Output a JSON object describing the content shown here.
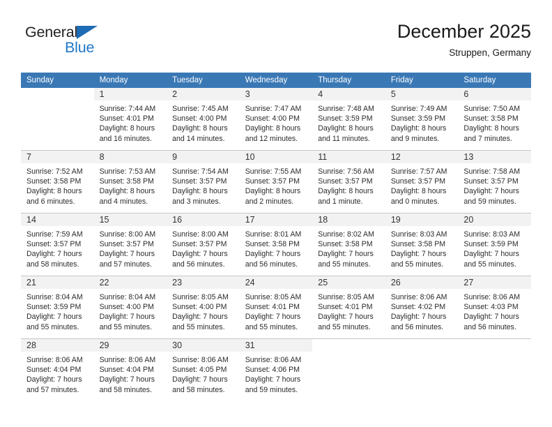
{
  "brand": {
    "name_part1": "General",
    "name_part2": "Blue",
    "triangle_color": "#1e6cb5",
    "blue_color": "#1e77c8"
  },
  "header": {
    "title": "December 2025",
    "subtitle": "Struppen, Germany"
  },
  "theme": {
    "header_row_background": "#3a78b5",
    "header_row_text": "#ffffff",
    "daynum_band_background": "#f2f2f2",
    "grid_line": "#c8c8c8"
  },
  "weekdays": [
    "Sunday",
    "Monday",
    "Tuesday",
    "Wednesday",
    "Thursday",
    "Friday",
    "Saturday"
  ],
  "weeks": [
    [
      {
        "day": "",
        "blank": true,
        "sunrise": "",
        "sunset": "",
        "daylight_line1": "",
        "daylight_line2": ""
      },
      {
        "day": "1",
        "sunrise": "Sunrise: 7:44 AM",
        "sunset": "Sunset: 4:01 PM",
        "daylight_line1": "Daylight: 8 hours",
        "daylight_line2": "and 16 minutes."
      },
      {
        "day": "2",
        "sunrise": "Sunrise: 7:45 AM",
        "sunset": "Sunset: 4:00 PM",
        "daylight_line1": "Daylight: 8 hours",
        "daylight_line2": "and 14 minutes."
      },
      {
        "day": "3",
        "sunrise": "Sunrise: 7:47 AM",
        "sunset": "Sunset: 4:00 PM",
        "daylight_line1": "Daylight: 8 hours",
        "daylight_line2": "and 12 minutes."
      },
      {
        "day": "4",
        "sunrise": "Sunrise: 7:48 AM",
        "sunset": "Sunset: 3:59 PM",
        "daylight_line1": "Daylight: 8 hours",
        "daylight_line2": "and 11 minutes."
      },
      {
        "day": "5",
        "sunrise": "Sunrise: 7:49 AM",
        "sunset": "Sunset: 3:59 PM",
        "daylight_line1": "Daylight: 8 hours",
        "daylight_line2": "and 9 minutes."
      },
      {
        "day": "6",
        "sunrise": "Sunrise: 7:50 AM",
        "sunset": "Sunset: 3:58 PM",
        "daylight_line1": "Daylight: 8 hours",
        "daylight_line2": "and 7 minutes."
      }
    ],
    [
      {
        "day": "7",
        "sunrise": "Sunrise: 7:52 AM",
        "sunset": "Sunset: 3:58 PM",
        "daylight_line1": "Daylight: 8 hours",
        "daylight_line2": "and 6 minutes."
      },
      {
        "day": "8",
        "sunrise": "Sunrise: 7:53 AM",
        "sunset": "Sunset: 3:58 PM",
        "daylight_line1": "Daylight: 8 hours",
        "daylight_line2": "and 4 minutes."
      },
      {
        "day": "9",
        "sunrise": "Sunrise: 7:54 AM",
        "sunset": "Sunset: 3:57 PM",
        "daylight_line1": "Daylight: 8 hours",
        "daylight_line2": "and 3 minutes."
      },
      {
        "day": "10",
        "sunrise": "Sunrise: 7:55 AM",
        "sunset": "Sunset: 3:57 PM",
        "daylight_line1": "Daylight: 8 hours",
        "daylight_line2": "and 2 minutes."
      },
      {
        "day": "11",
        "sunrise": "Sunrise: 7:56 AM",
        "sunset": "Sunset: 3:57 PM",
        "daylight_line1": "Daylight: 8 hours",
        "daylight_line2": "and 1 minute."
      },
      {
        "day": "12",
        "sunrise": "Sunrise: 7:57 AM",
        "sunset": "Sunset: 3:57 PM",
        "daylight_line1": "Daylight: 8 hours",
        "daylight_line2": "and 0 minutes."
      },
      {
        "day": "13",
        "sunrise": "Sunrise: 7:58 AM",
        "sunset": "Sunset: 3:57 PM",
        "daylight_line1": "Daylight: 7 hours",
        "daylight_line2": "and 59 minutes."
      }
    ],
    [
      {
        "day": "14",
        "sunrise": "Sunrise: 7:59 AM",
        "sunset": "Sunset: 3:57 PM",
        "daylight_line1": "Daylight: 7 hours",
        "daylight_line2": "and 58 minutes."
      },
      {
        "day": "15",
        "sunrise": "Sunrise: 8:00 AM",
        "sunset": "Sunset: 3:57 PM",
        "daylight_line1": "Daylight: 7 hours",
        "daylight_line2": "and 57 minutes."
      },
      {
        "day": "16",
        "sunrise": "Sunrise: 8:00 AM",
        "sunset": "Sunset: 3:57 PM",
        "daylight_line1": "Daylight: 7 hours",
        "daylight_line2": "and 56 minutes."
      },
      {
        "day": "17",
        "sunrise": "Sunrise: 8:01 AM",
        "sunset": "Sunset: 3:58 PM",
        "daylight_line1": "Daylight: 7 hours",
        "daylight_line2": "and 56 minutes."
      },
      {
        "day": "18",
        "sunrise": "Sunrise: 8:02 AM",
        "sunset": "Sunset: 3:58 PM",
        "daylight_line1": "Daylight: 7 hours",
        "daylight_line2": "and 55 minutes."
      },
      {
        "day": "19",
        "sunrise": "Sunrise: 8:03 AM",
        "sunset": "Sunset: 3:58 PM",
        "daylight_line1": "Daylight: 7 hours",
        "daylight_line2": "and 55 minutes."
      },
      {
        "day": "20",
        "sunrise": "Sunrise: 8:03 AM",
        "sunset": "Sunset: 3:59 PM",
        "daylight_line1": "Daylight: 7 hours",
        "daylight_line2": "and 55 minutes."
      }
    ],
    [
      {
        "day": "21",
        "sunrise": "Sunrise: 8:04 AM",
        "sunset": "Sunset: 3:59 PM",
        "daylight_line1": "Daylight: 7 hours",
        "daylight_line2": "and 55 minutes."
      },
      {
        "day": "22",
        "sunrise": "Sunrise: 8:04 AM",
        "sunset": "Sunset: 4:00 PM",
        "daylight_line1": "Daylight: 7 hours",
        "daylight_line2": "and 55 minutes."
      },
      {
        "day": "23",
        "sunrise": "Sunrise: 8:05 AM",
        "sunset": "Sunset: 4:00 PM",
        "daylight_line1": "Daylight: 7 hours",
        "daylight_line2": "and 55 minutes."
      },
      {
        "day": "24",
        "sunrise": "Sunrise: 8:05 AM",
        "sunset": "Sunset: 4:01 PM",
        "daylight_line1": "Daylight: 7 hours",
        "daylight_line2": "and 55 minutes."
      },
      {
        "day": "25",
        "sunrise": "Sunrise: 8:05 AM",
        "sunset": "Sunset: 4:01 PM",
        "daylight_line1": "Daylight: 7 hours",
        "daylight_line2": "and 55 minutes."
      },
      {
        "day": "26",
        "sunrise": "Sunrise: 8:06 AM",
        "sunset": "Sunset: 4:02 PM",
        "daylight_line1": "Daylight: 7 hours",
        "daylight_line2": "and 56 minutes."
      },
      {
        "day": "27",
        "sunrise": "Sunrise: 8:06 AM",
        "sunset": "Sunset: 4:03 PM",
        "daylight_line1": "Daylight: 7 hours",
        "daylight_line2": "and 56 minutes."
      }
    ],
    [
      {
        "day": "28",
        "sunrise": "Sunrise: 8:06 AM",
        "sunset": "Sunset: 4:04 PM",
        "daylight_line1": "Daylight: 7 hours",
        "daylight_line2": "and 57 minutes."
      },
      {
        "day": "29",
        "sunrise": "Sunrise: 8:06 AM",
        "sunset": "Sunset: 4:04 PM",
        "daylight_line1": "Daylight: 7 hours",
        "daylight_line2": "and 58 minutes."
      },
      {
        "day": "30",
        "sunrise": "Sunrise: 8:06 AM",
        "sunset": "Sunset: 4:05 PM",
        "daylight_line1": "Daylight: 7 hours",
        "daylight_line2": "and 58 minutes."
      },
      {
        "day": "31",
        "sunrise": "Sunrise: 8:06 AM",
        "sunset": "Sunset: 4:06 PM",
        "daylight_line1": "Daylight: 7 hours",
        "daylight_line2": "and 59 minutes."
      },
      {
        "day": "",
        "blank": true,
        "sunrise": "",
        "sunset": "",
        "daylight_line1": "",
        "daylight_line2": ""
      },
      {
        "day": "",
        "blank": true,
        "sunrise": "",
        "sunset": "",
        "daylight_line1": "",
        "daylight_line2": ""
      },
      {
        "day": "",
        "blank": true,
        "sunrise": "",
        "sunset": "",
        "daylight_line1": "",
        "daylight_line2": ""
      }
    ]
  ]
}
